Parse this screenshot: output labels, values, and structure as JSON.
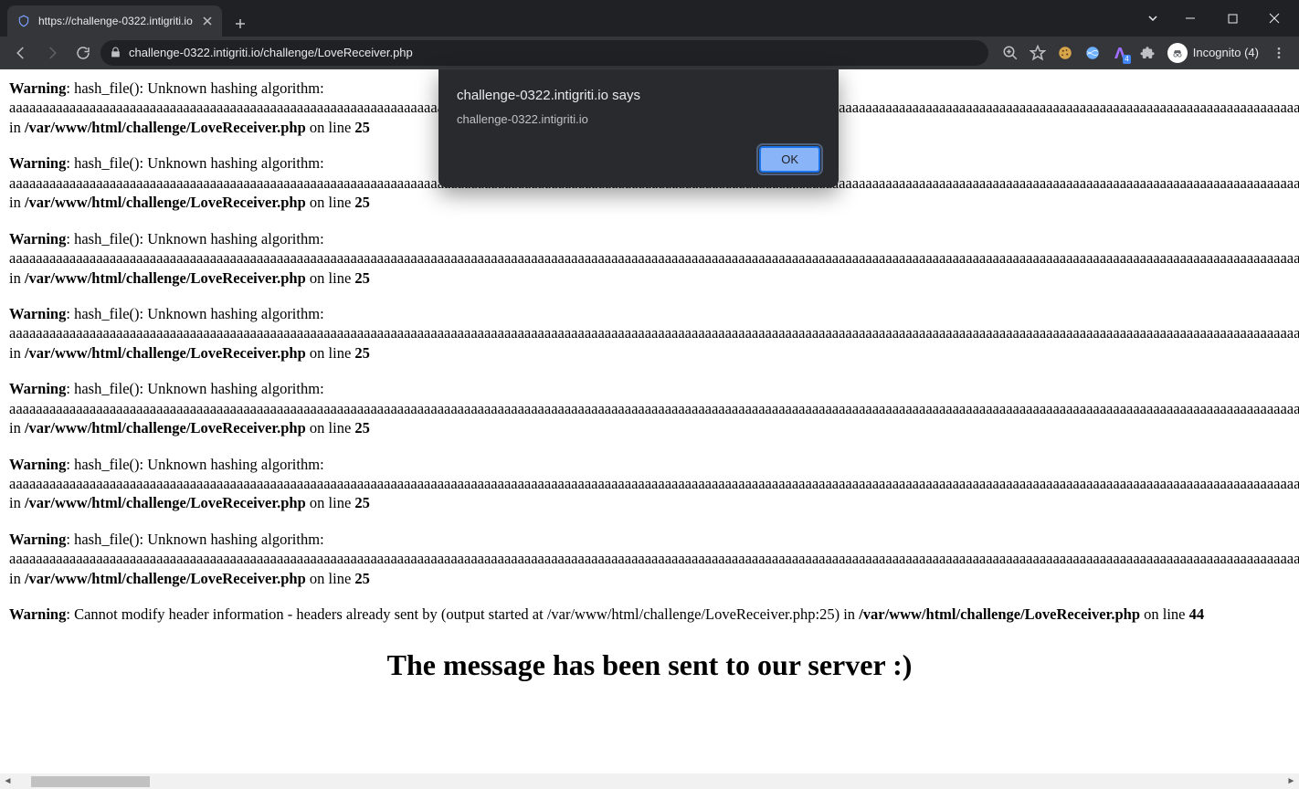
{
  "tab": {
    "title": "https://challenge-0322.intigriti.io"
  },
  "url": "challenge-0322.intigriti.io/challenge/LoveReceiver.php",
  "incognito": {
    "label": "Incognito (4)"
  },
  "dialog": {
    "title": "challenge-0322.intigriti.io says",
    "message": "challenge-0322.intigriti.io",
    "ok": "OK"
  },
  "warning_label": "Warning",
  "warnings": [
    {
      "msg1": ": hash_file(): Unknown hashing algorithm:",
      "payload": "aaaaaaaaaaaaaaaaaaaaaaaaaaaaaaaaaaaaaaaaaaaaaaaaaaaaaaaaaaaaaaaaaaaaaaaaaaaaaaaaaaaaaaaaaaaaaaaaaaaaaaaaaaaaaaaaaaaaaaaaaaaaaaaaaaaaaaaaaaaaaaaaaaaaaaaaaaaaaaaaaaaaaaaaaaaaaaaaaaaaaaaaaaaaaaaaaaaaaaaaaaaaaaaaaaaaaaaaaaaaaaaaaaaaaaaaaaaaaaaaaaaaaaaaaaaaaaaaaaaaaaaaaaaaaaaaaaaaaaaaaaaaaaaaaaaaaaaaaaaaaaaaaaaaaaaaaaaaaaaa",
      "in": " in ",
      "file": "/var/www/html/challenge/LoveReceiver.php",
      "online": " on line ",
      "line": "25"
    },
    {
      "msg1": ": hash_file(): Unknown hashing algorithm:",
      "payload": "aaaaaaaaaaaaaaaaaaaaaaaaaaaaaaaaaaaaaaaaaaaaaaaaaaaaaaaaaaaaaaaaaaaaaaaaaaaaaaaaaaaaaaaaaaaaaaaaaaaaaaaaaaaaaaaaaaaaaaaaaaaaaaaaaaaaaaaaaaaaaaaaaaaaaaaaaaaaaaaaaaaaaaaaaaaaaaaaaaaaaaaaaaaaaaaaaaaaaaaaaaaaaaaaaaaaaaaaaaaaaaaaaaaaaaaaaaaaaaaaaaaaaaaaaaaaaaaaaaaaaaaaaaaaaaaaaaaaaaaaaaaaaaaaaaaaaaaaaaaaaaaaaaaaaaaaaaaaaaaa",
      "in": " in ",
      "file": "/var/www/html/challenge/LoveReceiver.php",
      "online": " on line ",
      "line": "25"
    },
    {
      "msg1": ": hash_file(): Unknown hashing algorithm:",
      "payload": "aaaaaaaaaaaaaaaaaaaaaaaaaaaaaaaaaaaaaaaaaaaaaaaaaaaaaaaaaaaaaaaaaaaaaaaaaaaaaaaaaaaaaaaaaaaaaaaaaaaaaaaaaaaaaaaaaaaaaaaaaaaaaaaaaaaaaaaaaaaaaaaaaaaaaaaaaaaaaaaaaaaaaaaaaaaaaaaaaaaaaaaaaaaaaaaaaaaaaaaaaaaaaaaaaaaaaaaaaaaaaaaaaaaaaaaaaaaaaaaaaaaaaaaaaaaaaaaaaaaaaaaaaaaaaaaaaaaaaaaaaaaaaaaaaaaaaaaaaaaaaaaaaaaaaaaaaaaaaaaa",
      "in": " in ",
      "file": "/var/www/html/challenge/LoveReceiver.php",
      "online": " on line ",
      "line": "25"
    },
    {
      "msg1": ": hash_file(): Unknown hashing algorithm:",
      "payload": "aaaaaaaaaaaaaaaaaaaaaaaaaaaaaaaaaaaaaaaaaaaaaaaaaaaaaaaaaaaaaaaaaaaaaaaaaaaaaaaaaaaaaaaaaaaaaaaaaaaaaaaaaaaaaaaaaaaaaaaaaaaaaaaaaaaaaaaaaaaaaaaaaaaaaaaaaaaaaaaaaaaaaaaaaaaaaaaaaaaaaaaaaaaaaaaaaaaaaaaaaaaaaaaaaaaaaaaaaaaaaaaaaaaaaaaaaaaaaaaaaaaaaaaaaaaaaaaaaaaaaaaaaaaaaaaaaaaaaaaaaaaaaaaaaaaaaaaaaaaaaaaaaaaaaaaaaaaaaaaa",
      "in": " in ",
      "file": "/var/www/html/challenge/LoveReceiver.php",
      "online": " on line ",
      "line": "25"
    },
    {
      "msg1": ": hash_file(): Unknown hashing algorithm:",
      "payload": "aaaaaaaaaaaaaaaaaaaaaaaaaaaaaaaaaaaaaaaaaaaaaaaaaaaaaaaaaaaaaaaaaaaaaaaaaaaaaaaaaaaaaaaaaaaaaaaaaaaaaaaaaaaaaaaaaaaaaaaaaaaaaaaaaaaaaaaaaaaaaaaaaaaaaaaaaaaaaaaaaaaaaaaaaaaaaaaaaaaaaaaaaaaaaaaaaaaaaaaaaaaaaaaaaaaaaaaaaaaaaaaaaaaaaaaaaaaaaaaaaaaaaaaaaaaaaaaaaaaaaaaaaaaaaaaaaaaaaaaaaaaaaaaaaaaaaaaaaaaaaaaaaaaaaaaaaaaaaaaa",
      "in": " in ",
      "file": "/var/www/html/challenge/LoveReceiver.php",
      "online": " on line ",
      "line": "25"
    },
    {
      "msg1": ": hash_file(): Unknown hashing algorithm:",
      "payload": "aaaaaaaaaaaaaaaaaaaaaaaaaaaaaaaaaaaaaaaaaaaaaaaaaaaaaaaaaaaaaaaaaaaaaaaaaaaaaaaaaaaaaaaaaaaaaaaaaaaaaaaaaaaaaaaaaaaaaaaaaaaaaaaaaaaaaaaaaaaaaaaaaaaaaaaaaaaaaaaaaaaaaaaaaaaaaaaaaaaaaaaaaaaaaaaaaaaaaaaaaaaaaaaaaaaaaaaaaaaaaaaaaaaaaaaaaaaaaaaaaaaaaaaaaaaaaaaaaaaaaaaaaaaaaaaaaaaaaaaaaaaaaaaaaaaaaaaaaaaaaaaaaaaaaaaaaaaaaaaa",
      "in": " in ",
      "file": "/var/www/html/challenge/LoveReceiver.php",
      "online": " on line ",
      "line": "25"
    },
    {
      "msg1": ": hash_file(): Unknown hashing algorithm:",
      "payload": "aaaaaaaaaaaaaaaaaaaaaaaaaaaaaaaaaaaaaaaaaaaaaaaaaaaaaaaaaaaaaaaaaaaaaaaaaaaaaaaaaaaaaaaaaaaaaaaaaaaaaaaaaaaaaaaaaaaaaaaaaaaaaaaaaaaaaaaaaaaaaaaaaaaaaaaaaaaaaaaaaaaaaaaaaaaaaaaaaaaaaaaaaaaaaaaaaaaaaaaaaaaaaaaaaaaaaaaaaaaaaaaaaaaaaaaaaaaaaaaaaaaaaaaaaaaaaaaaaaaaaaaaaaaaaaaaaaaaaaaaaaaaaaaaaaaaaaaaaaaaaaaaaaaaaaaaaaaaaaaa",
      "in": " in ",
      "file": "/var/www/html/challenge/LoveReceiver.php",
      "online": " on line ",
      "line": "25"
    }
  ],
  "header_warning": {
    "msg": ": Cannot modify header information - headers already sent by (output started at /var/www/html/challenge/LoveReceiver.php:25) in ",
    "file": "/var/www/html/challenge/LoveReceiver.php",
    "online": " on line ",
    "line": "44"
  },
  "heading": "The message has been sent to our server :)"
}
